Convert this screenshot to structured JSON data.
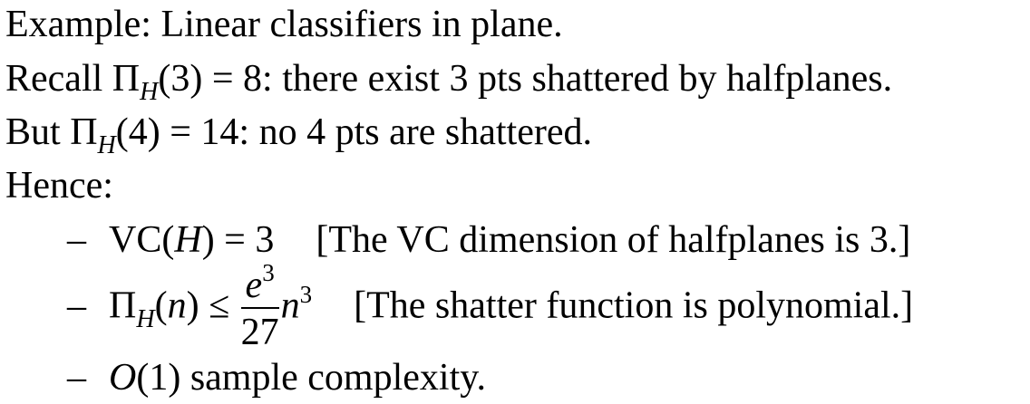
{
  "lines": {
    "example": "Example: Linear classifiers in plane.",
    "recall_prefix": "Recall",
    "recall_pi": "Π",
    "recall_sub": "H",
    "recall_arg": "(3) = 8: there exist 3 pts shattered by halfplanes.",
    "but_prefix": "But",
    "but_pi": "Π",
    "but_sub": "H",
    "but_arg": "(4) = 14: no 4 pts are shattered.",
    "hence": "Hence:"
  },
  "bullets": {
    "dash": "–",
    "vc_text_a": "VC(",
    "vc_var": "H",
    "vc_text_b": ") = 3",
    "vc_note": "[The VC dimension of halfplanes is 3.]",
    "pi_sym": "Π",
    "pi_sub": "H",
    "pi_open": "(",
    "pi_var": "n",
    "pi_close": ") ≤",
    "frac_num_base": "e",
    "frac_num_exp": "3",
    "frac_den": "27",
    "pi_rhs_var": "n",
    "pi_rhs_exp": "3",
    "pi_note": "[The shatter function is polynomial.]",
    "o_sym": "O",
    "o_text": "(1) sample complexity."
  }
}
